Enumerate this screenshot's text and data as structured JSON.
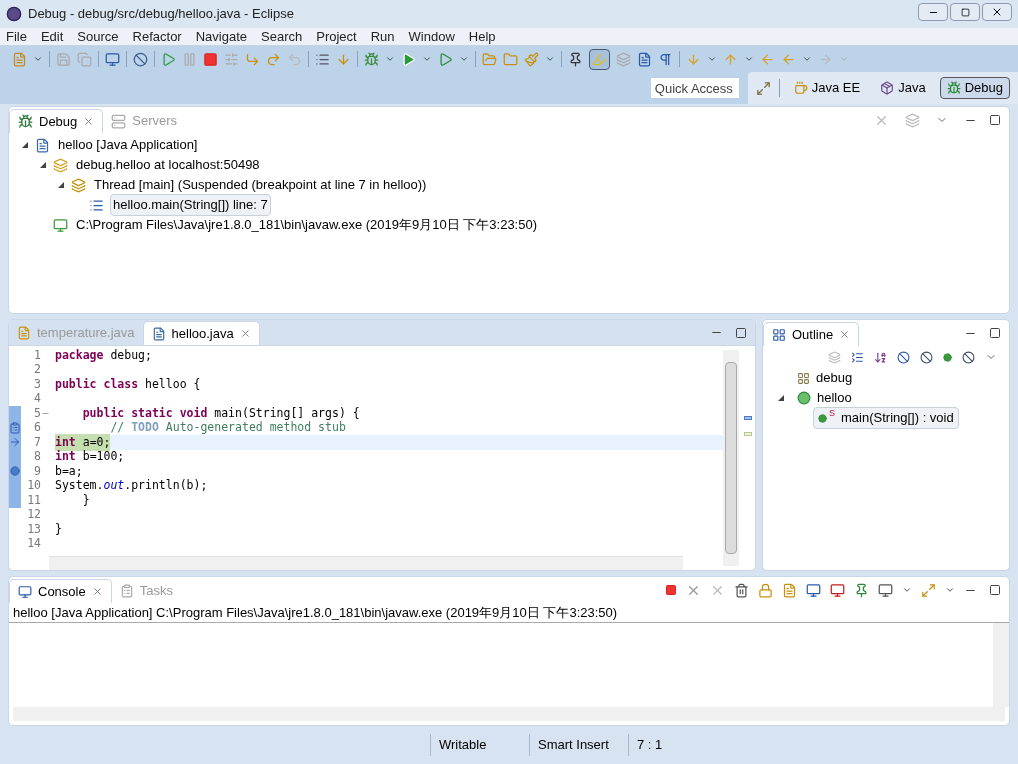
{
  "window": {
    "title": "Debug - debug/src/debug/helloo.java - Eclipse"
  },
  "menu": [
    "File",
    "Edit",
    "Source",
    "Refactor",
    "Navigate",
    "Search",
    "Project",
    "Run",
    "Window",
    "Help"
  ],
  "quick_access": {
    "placeholder": "Quick Access"
  },
  "perspectives": [
    {
      "label": "Java EE",
      "selected": false,
      "kind": "javaee"
    },
    {
      "label": "Java",
      "selected": false,
      "kind": "java"
    },
    {
      "label": "Debug",
      "selected": true,
      "kind": "debug"
    }
  ],
  "debug_view": {
    "tabs": [
      {
        "label": "Debug",
        "selected": true,
        "kind": "debug"
      },
      {
        "label": "Servers",
        "selected": false,
        "kind": "servers"
      }
    ],
    "tree": [
      {
        "label": "helloo [Java Application]",
        "kind": "launch",
        "expanded": true,
        "selected": false,
        "children": [
          {
            "label": "debug.helloo at localhost:50498",
            "kind": "target",
            "expanded": true,
            "selected": false,
            "children": [
              {
                "label": "Thread [main] (Suspended (breakpoint at line 7 in helloo))",
                "kind": "thread",
                "expanded": true,
                "selected": false,
                "children": [
                  {
                    "label": "helloo.main(String[]) line: 7",
                    "kind": "frame",
                    "selected": true
                  }
                ]
              }
            ]
          },
          {
            "label": "C:\\Program Files\\Java\\jre1.8.0_181\\bin\\javaw.exe (2019年9月10日 下午3:23:50)",
            "kind": "process",
            "selected": false
          }
        ]
      }
    ]
  },
  "editor": {
    "tabs": [
      {
        "label": "temperature.java",
        "selected": false,
        "warning": true
      },
      {
        "label": "helloo.java",
        "selected": true,
        "warning": false
      }
    ],
    "lines": [
      {
        "number": "1",
        "in_frame": false,
        "tokens": [
          {
            "text": "package",
            "kind": "keyword"
          },
          {
            "text": " debug;",
            "kind": "plain"
          }
        ]
      },
      {
        "number": "2",
        "in_frame": false
      },
      {
        "number": "3",
        "in_frame": false,
        "tokens": [
          {
            "text": "public",
            "kind": "keyword"
          },
          {
            "text": " class",
            "kind": "keyword"
          },
          {
            "text": " helloo {",
            "kind": "plain"
          }
        ]
      },
      {
        "number": "4",
        "in_frame": false
      },
      {
        "number": "5",
        "fold": true,
        "in_frame": true,
        "tokens": [
          {
            "text": "    public",
            "kind": "keyword"
          },
          {
            "text": " static",
            "kind": "keyword"
          },
          {
            "text": " void",
            "kind": "keyword"
          },
          {
            "text": " main(String[] args) {",
            "kind": "plain"
          }
        ]
      },
      {
        "number": "6",
        "in_frame": true,
        "kind": "task",
        "tokens": [
          {
            "text": "        // ",
            "kind": "comment"
          },
          {
            "text": "TODO",
            "kind": "todo"
          },
          {
            "text": " Auto-generated method stub",
            "kind": "comment"
          }
        ]
      },
      {
        "number": "7",
        "in_frame": true,
        "kind": "pointer",
        "current": true,
        "tokens": [
          {
            "text": "int",
            "kind": "keyword_hl"
          },
          {
            "text": " a=0;",
            "kind": "plain_hl"
          }
        ]
      },
      {
        "number": "8",
        "in_frame": true,
        "tokens": [
          {
            "text": "int",
            "kind": "keyword"
          },
          {
            "text": " b=100;",
            "kind": "plain"
          }
        ]
      },
      {
        "number": "9",
        "in_frame": true,
        "kind": "breakpoint",
        "tokens": [
          {
            "text": "b=a;",
            "kind": "plain"
          }
        ]
      },
      {
        "number": "10",
        "in_frame": true,
        "tokens": [
          {
            "text": "System.",
            "kind": "plain"
          },
          {
            "text": "out",
            "kind": "field"
          },
          {
            "text": ".println(b);",
            "kind": "plain"
          }
        ]
      },
      {
        "number": "11",
        "in_frame": true,
        "tokens": [
          {
            "text": "    }",
            "kind": "plain"
          }
        ]
      },
      {
        "number": "12",
        "in_frame": false
      },
      {
        "number": "13",
        "in_frame": false,
        "tokens": [
          {
            "text": "}",
            "kind": "plain"
          }
        ]
      },
      {
        "number": "14",
        "in_frame": false
      }
    ]
  },
  "outline": {
    "tab": {
      "label": "Outline",
      "selected": true
    },
    "items": [
      {
        "label": "debug",
        "kind": "package",
        "selected": false
      },
      {
        "label": "helloo",
        "kind": "class",
        "expanded": true,
        "selected": false,
        "children": [
          {
            "label": "main(String[]) : void",
            "kind": "method",
            "badge": "S",
            "selected": true
          }
        ]
      }
    ]
  },
  "console": {
    "tabs": [
      {
        "label": "Console",
        "selected": true,
        "kind": "console"
      },
      {
        "label": "Tasks",
        "selected": false,
        "kind": "tasks"
      }
    ],
    "header": "helloo [Java Application] C:\\Program Files\\Java\\jre1.8.0_181\\bin\\javaw.exe (2019年9月10日 下午3:23:50)"
  },
  "status_bar": [
    "Writable",
    "Smart Insert",
    "7 : 1"
  ]
}
